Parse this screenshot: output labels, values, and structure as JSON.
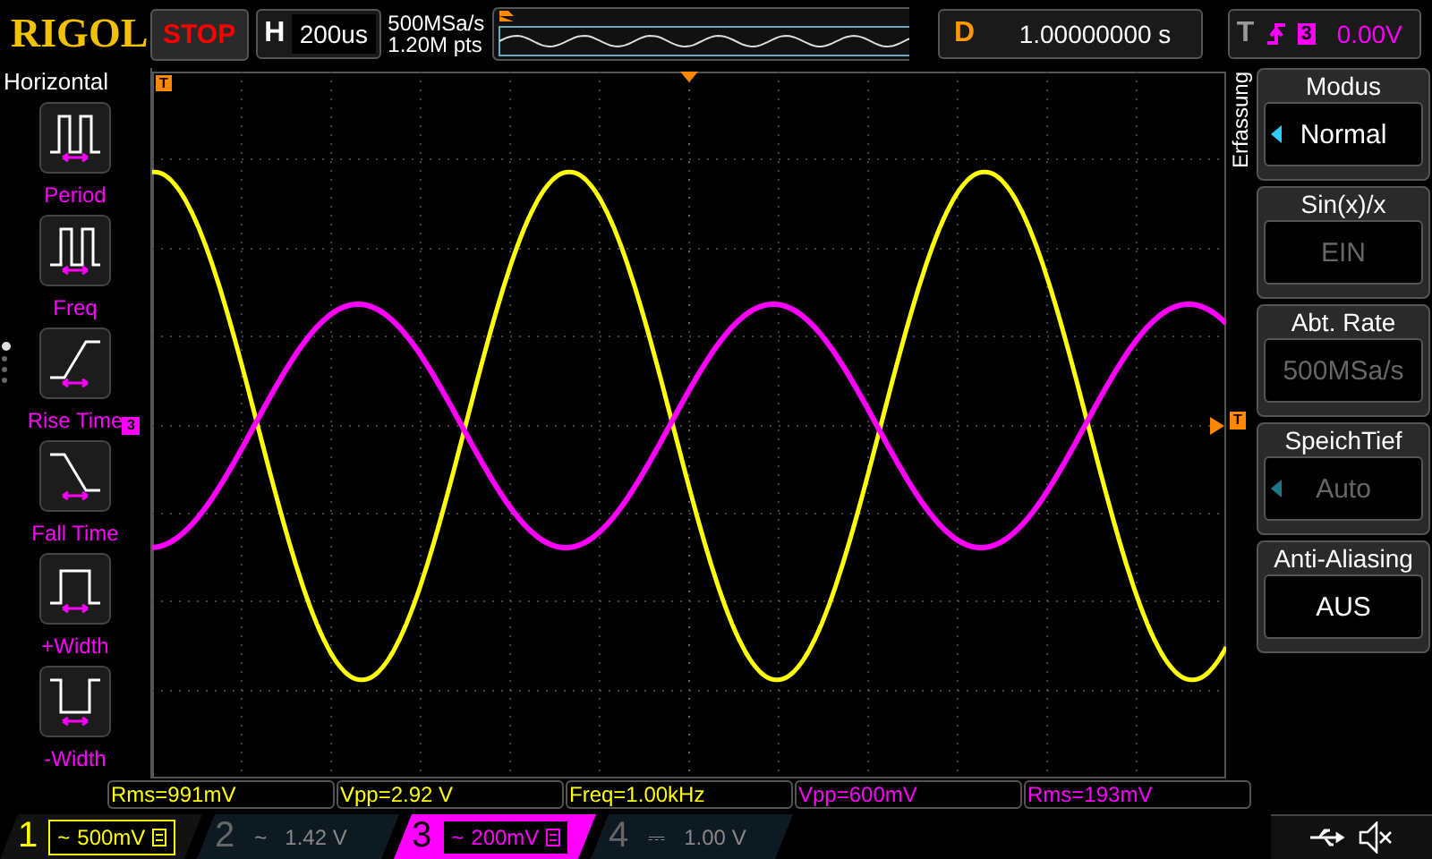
{
  "header": {
    "logo": "RIGOL",
    "run_state": "STOP",
    "horizontal": {
      "label": "H",
      "value": "200us"
    },
    "sample_rate": "500MSa/s",
    "memory_depth": "1.20M pts",
    "delay": {
      "label": "D",
      "value": "1.00000000 s"
    },
    "trigger": {
      "label": "T",
      "source": "3",
      "level": "0.00V"
    }
  },
  "left_menu": {
    "title": "Horizontal",
    "items": [
      {
        "kind": "period",
        "label": "Period"
      },
      {
        "kind": "freq",
        "label": "Freq"
      },
      {
        "kind": "rise",
        "label": "Rise Time"
      },
      {
        "kind": "fall",
        "label": "Fall Time"
      },
      {
        "kind": "pwidth",
        "label": "+Width"
      },
      {
        "kind": "nwidth",
        "label": "-Width"
      }
    ],
    "pages": [
      {
        "selected": true
      },
      {
        "selected": false
      },
      {
        "selected": false
      },
      {
        "selected": false
      }
    ]
  },
  "graph": {
    "trigger_marker": "T",
    "channel_marker": "3"
  },
  "right_menu": {
    "tab": "Erfassung",
    "items": [
      {
        "title": "Modus",
        "value": "Normal",
        "disabled": false,
        "has_options": true
      },
      {
        "title": "Sin(x)/x",
        "value": "EIN",
        "disabled": true,
        "has_options": false
      },
      {
        "title": "Abt. Rate",
        "value": "500MSa/s",
        "disabled": true,
        "has_options": false
      },
      {
        "title": "SpeichTief",
        "value": "Auto",
        "disabled": true,
        "has_options": true
      },
      {
        "title": "Anti-Aliasing",
        "value": "AUS",
        "disabled": false,
        "has_options": false
      }
    ],
    "trigger_marker": "T"
  },
  "measurements": [
    {
      "text": "Rms=991mV",
      "color": "#ffff00"
    },
    {
      "text": "Vpp=2.92 V",
      "color": "#ffff00"
    },
    {
      "text": "Freq=1.00kHz",
      "color": "#ffff00"
    },
    {
      "text": "Vpp=600mV",
      "color": "#ff00ff"
    },
    {
      "text": "Rms=193mV",
      "color": "#ff00ff"
    }
  ],
  "channels": [
    {
      "number": "1",
      "coupling": "~",
      "reading": "500mV",
      "on": true,
      "selected": false,
      "color": "#ffff00"
    },
    {
      "number": "2",
      "coupling": "~",
      "reading": "1.42 V",
      "on": false,
      "selected": false
    },
    {
      "number": "3",
      "coupling": "~",
      "reading": "200mV",
      "on": true,
      "selected": true,
      "color": "#ff00ff"
    },
    {
      "number": "4",
      "coupling": "⎓",
      "reading": "1.00 V",
      "on": false,
      "selected": false
    }
  ]
}
